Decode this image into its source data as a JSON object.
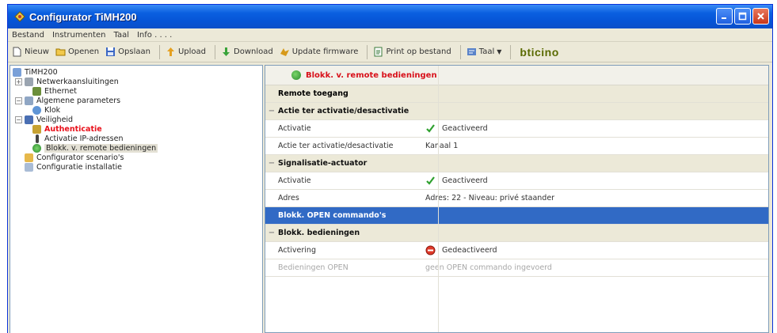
{
  "window": {
    "title": "Configurator TiMH200"
  },
  "menu": [
    "Bestand",
    "Instrumenten",
    "Taal",
    "Info . . . ."
  ],
  "toolbar": {
    "new": "Nieuw",
    "open": "Openen",
    "save": "Opslaan",
    "upload": "Upload",
    "download": "Download",
    "update_firmware": "Update firmware",
    "print": "Print op bestand",
    "language": "Taal",
    "brand": "bticino"
  },
  "tree": {
    "root": "TiMH200",
    "items": [
      {
        "label": "Netwerkaansluitingen",
        "level": 1,
        "expander": "+"
      },
      {
        "label": "Ethernet",
        "level": 2
      },
      {
        "label": "Algemene parameters",
        "level": 1,
        "expander": "−"
      },
      {
        "label": "Klok",
        "level": 2
      },
      {
        "label": "Veiligheid",
        "level": 1,
        "expander": "−"
      },
      {
        "label": "Authenticatie",
        "level": 2
      },
      {
        "label": "Activatie IP-adressen",
        "level": 2
      },
      {
        "label": "Blokk. v. remote bedieningen",
        "level": 2
      },
      {
        "label": "Configurator scenario's",
        "level": 1
      },
      {
        "label": "Configuratie installatie",
        "level": 1
      }
    ]
  },
  "grid": {
    "header": "Blokk. v. remote bedieningen",
    "top_section": "Remote toegang",
    "sections": [
      {
        "title": "Actie ter activatie/desactivatie",
        "rows": [
          {
            "prop": "Activatie",
            "value": "Geactiveerd",
            "icon": "check-icon"
          },
          {
            "prop": "Actie ter activatie/desactivatie",
            "value": "Kanaal 1"
          }
        ]
      },
      {
        "title": "Signalisatie-actuator",
        "rows": [
          {
            "prop": "Activatie",
            "value": "Geactiveerd",
            "icon": "check-icon"
          },
          {
            "prop": "Adres",
            "value": "Adres: 22 - Niveau: privé staander"
          }
        ]
      }
    ],
    "highlight_row": "Blokk. OPEN commando's",
    "section3": {
      "title": "Blokk. bedieningen",
      "rows": [
        {
          "prop": "Activering",
          "value": "Gedeactiveerd",
          "icon": "stop-icon"
        },
        {
          "prop": "Bedieningen OPEN",
          "value": "geen OPEN commando ingevoerd"
        }
      ]
    }
  },
  "colors": {
    "title_blue": "#0654d6",
    "selection": "#316ac5",
    "red_text": "#e8101a"
  }
}
